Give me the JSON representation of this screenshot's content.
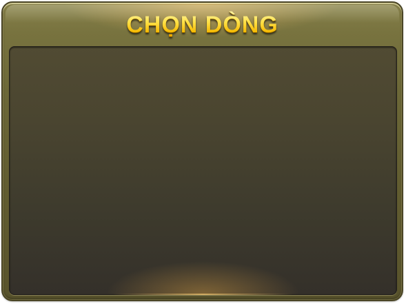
{
  "dialog": {
    "title": "CHỌN DÒNG"
  },
  "colors": {
    "frame": "#6c6838",
    "title_gold": "#ffd426",
    "panel": "#423e2f"
  }
}
